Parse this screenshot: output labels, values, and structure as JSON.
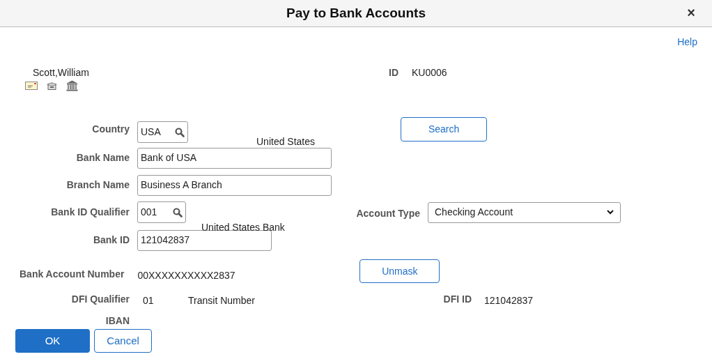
{
  "window": {
    "title": "Pay to Bank Accounts",
    "close": "×"
  },
  "help": "Help",
  "employee": {
    "name": "Scott,William",
    "id_label": "ID",
    "id_value": "KU0006"
  },
  "country": {
    "label": "Country",
    "value": "USA",
    "description": "United States"
  },
  "search_button": "Search",
  "bank_name": {
    "label": "Bank Name",
    "value": "Bank of USA"
  },
  "branch_name": {
    "label": "Branch Name",
    "value": "Business A Branch"
  },
  "bank_id_qualifier": {
    "label": "Bank ID Qualifier",
    "value": "001",
    "description": "United States Bank"
  },
  "account_type": {
    "label": "Account Type",
    "value": "Checking Account"
  },
  "bank_id": {
    "label": "Bank ID",
    "value": "121042837"
  },
  "bank_account_number": {
    "label": "Bank Account Number",
    "value": "00XXXXXXXXXX2837"
  },
  "unmask_button": "Unmask",
  "dfi_qualifier": {
    "label": "DFI Qualifier",
    "value": "01",
    "description": "Transit Number"
  },
  "dfi_id": {
    "label": "DFI ID",
    "value": "121042837"
  },
  "iban": {
    "label": "IBAN"
  },
  "buttons": [
    {
      "label": "OK",
      "primary": true
    },
    {
      "label": "Cancel",
      "primary": false
    }
  ]
}
